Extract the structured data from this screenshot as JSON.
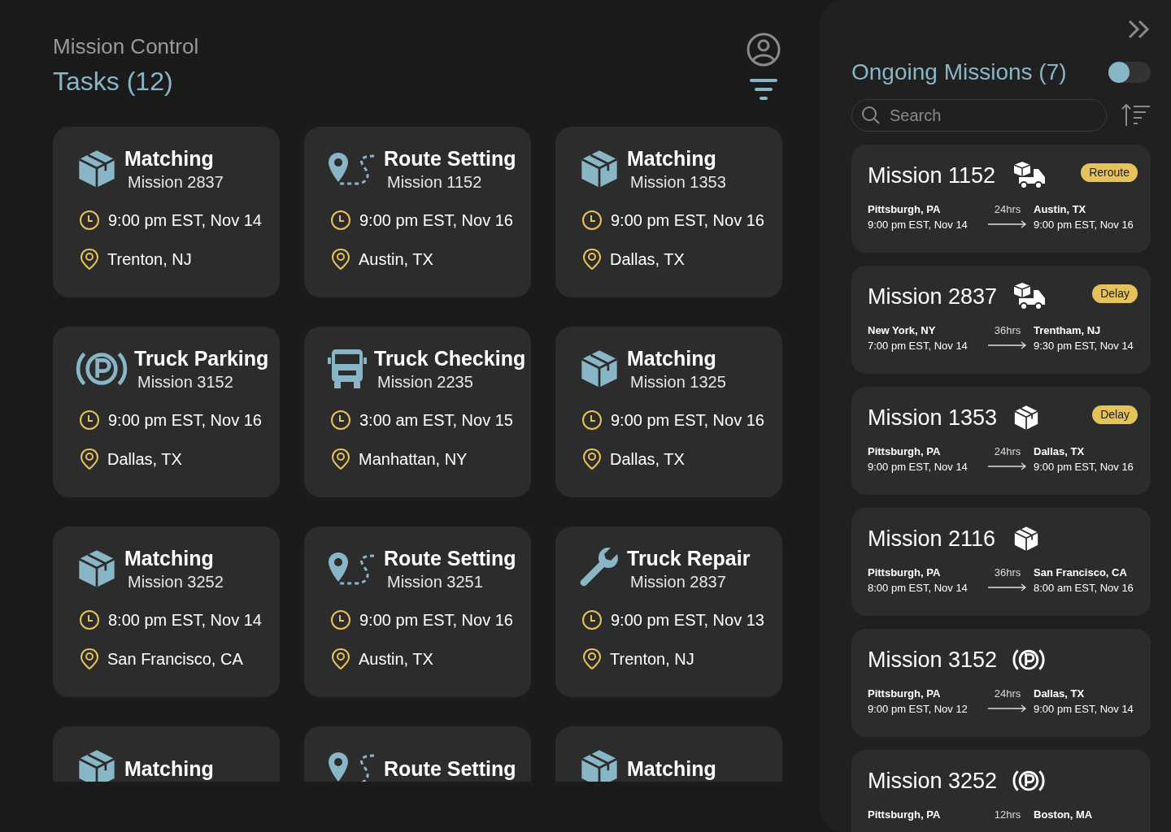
{
  "header": {
    "subtitle": "Mission Control",
    "title": "Tasks (12)"
  },
  "tasks": [
    {
      "kind": "box",
      "title": "Matching",
      "mission": "Mission 2837",
      "time": "9:00 pm EST, Nov 14",
      "location": "Trenton, NJ"
    },
    {
      "kind": "route",
      "title": "Route Setting",
      "mission": "Mission 1152",
      "time": "9:00 pm EST, Nov 16",
      "location": "Austin, TX"
    },
    {
      "kind": "box",
      "title": "Matching",
      "mission": "Mission 1353",
      "time": "9:00 pm EST, Nov 16",
      "location": "Dallas, TX"
    },
    {
      "kind": "parking",
      "title": "Truck Parking",
      "mission": "Mission 3152",
      "time": "9:00 pm EST, Nov 16",
      "location": "Dallas, TX"
    },
    {
      "kind": "truck",
      "title": "Truck Checking",
      "mission": "Mission 2235",
      "time": "3:00 am EST, Nov 15",
      "location": "Manhattan, NY"
    },
    {
      "kind": "box",
      "title": "Matching",
      "mission": "Mission 1325",
      "time": "9:00 pm EST, Nov 16",
      "location": "Dallas, TX"
    },
    {
      "kind": "box",
      "title": "Matching",
      "mission": "Mission 3252",
      "time": "8:00 pm EST, Nov 14",
      "location": "San Francisco, CA"
    },
    {
      "kind": "route",
      "title": "Route Setting",
      "mission": "Mission 3251",
      "time": "9:00 pm EST, Nov 16",
      "location": "Austin, TX"
    },
    {
      "kind": "wrench",
      "title": "Truck Repair",
      "mission": "Mission 2837",
      "time": "9:00 pm EST, Nov 13",
      "location": "Trenton, NJ"
    },
    {
      "kind": "box",
      "title": "Matching"
    },
    {
      "kind": "route",
      "title": "Route Setting"
    },
    {
      "kind": "box",
      "title": "Matching"
    }
  ],
  "panel": {
    "title": "Ongoing Missions (7)",
    "toggle_on": false,
    "search": {
      "placeholder": "Search"
    }
  },
  "missions": [
    {
      "name": "Mission 1152",
      "kind": "truck",
      "badge": "Reroute",
      "from": "Pittsburgh, PA",
      "from_time": "9:00 pm EST, Nov 14",
      "duration": "24hrs",
      "to": "Austin, TX",
      "to_time": "9:00 pm EST, Nov 16"
    },
    {
      "name": "Mission 2837",
      "kind": "truck",
      "badge": "Delay",
      "from": "New York, NY",
      "from_time": "7:00 pm EST, Nov 14",
      "duration": "36hrs",
      "to": "Trentham, NJ",
      "to_time": "9:30 pm EST, Nov 14"
    },
    {
      "name": "Mission 1353",
      "kind": "box",
      "badge": "Delay",
      "from": "Pittsburgh, PA",
      "from_time": "9:00 pm EST, Nov 14",
      "duration": "24hrs",
      "to": "Dallas, TX",
      "to_time": "9:00 pm EST, Nov 16"
    },
    {
      "name": "Mission 2116",
      "kind": "box",
      "from": "Pittsburgh, PA",
      "from_time": "8:00 pm EST, Nov 14",
      "duration": "36hrs",
      "to": "San Francisco, CA",
      "to_time": "8:00 am EST, Nov 16"
    },
    {
      "name": "Mission 3152",
      "kind": "parking",
      "from": "Pittsburgh, PA",
      "from_time": "9:00 pm EST, Nov 12",
      "duration": "24hrs",
      "to": "Dallas, TX",
      "to_time": "9:00 pm EST, Nov 14"
    },
    {
      "name": "Mission 3252",
      "kind": "parking",
      "from": "Pittsburgh, PA",
      "duration": "12hrs",
      "to": "Boston, MA"
    }
  ]
}
